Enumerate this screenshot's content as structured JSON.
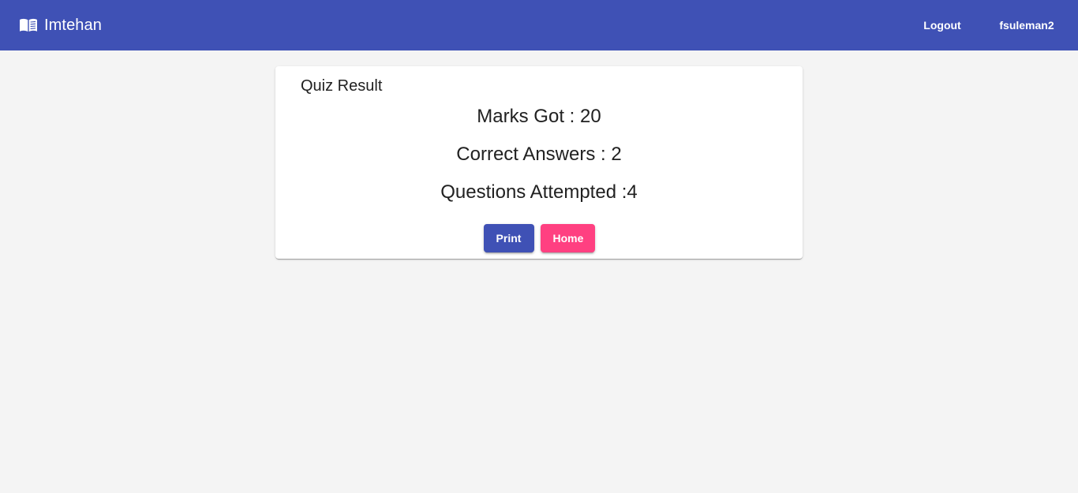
{
  "colors": {
    "primary": "#3f51b5",
    "accent": "#ff4081",
    "background": "#f4f4f4"
  },
  "header": {
    "brand_icon": "open-book-icon",
    "brand_title": "Imtehan",
    "logout_label": "Logout",
    "username": "fsuleman2"
  },
  "result": {
    "title": "Quiz Result",
    "marks_line": "Marks Got : 20",
    "correct_line": "Correct Answers : 2",
    "attempted_line": "Questions Attempted :4"
  },
  "actions": {
    "print_label": "Print",
    "home_label": "Home"
  }
}
